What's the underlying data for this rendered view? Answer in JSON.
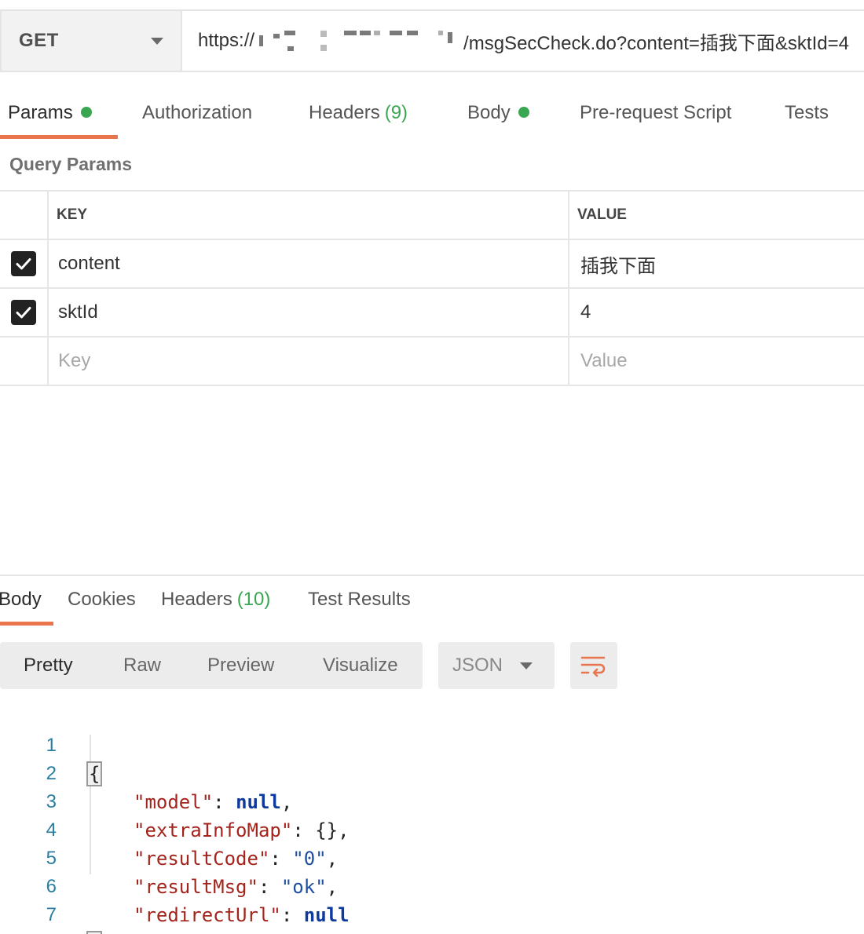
{
  "request": {
    "method": "GET",
    "url_prefix": "https://",
    "url_suffix": "/msgSecCheck.do?content=插我下面&sktId=4"
  },
  "request_tabs": {
    "params": "Params",
    "authorization": "Authorization",
    "headers": "Headers",
    "headers_count": "(9)",
    "body": "Body",
    "pre_request": "Pre-request Script",
    "tests": "Tests"
  },
  "query_params": {
    "title": "Query Params",
    "col_key": "KEY",
    "col_value": "VALUE",
    "rows": [
      {
        "key": "content",
        "value": "插我下面",
        "checked": true
      },
      {
        "key": "sktId",
        "value": "4",
        "checked": true
      }
    ],
    "key_placeholder": "Key",
    "value_placeholder": "Value"
  },
  "response_tabs": {
    "body": "Body",
    "cookies": "Cookies",
    "headers": "Headers",
    "headers_count": "(10)",
    "test_results": "Test Results"
  },
  "view_modes": {
    "pretty": "Pretty",
    "raw": "Raw",
    "preview": "Preview",
    "visualize": "Visualize",
    "format": "JSON",
    "wrap_icon": "wrap-lines-icon"
  },
  "response_body": {
    "line_numbers": [
      "1",
      "2",
      "3",
      "4",
      "5",
      "6",
      "7"
    ],
    "open_brace": "{",
    "close_brace": "}",
    "fields": [
      {
        "key": "\"model\"",
        "value": "null",
        "trail": ","
      },
      {
        "key": "\"extraInfoMap\"",
        "value": "{}",
        "trail": ","
      },
      {
        "key": "\"resultCode\"",
        "value": "\"0\"",
        "trail": ","
      },
      {
        "key": "\"resultMsg\"",
        "value": "\"ok\"",
        "trail": ","
      },
      {
        "key": "\"redirectUrl\"",
        "value": "null",
        "trail": ""
      }
    ]
  },
  "colors": {
    "accent": "#e8754e",
    "status_dot": "#3aa651",
    "json_key": "#a3241c",
    "json_keyword": "#0d3a9c"
  }
}
